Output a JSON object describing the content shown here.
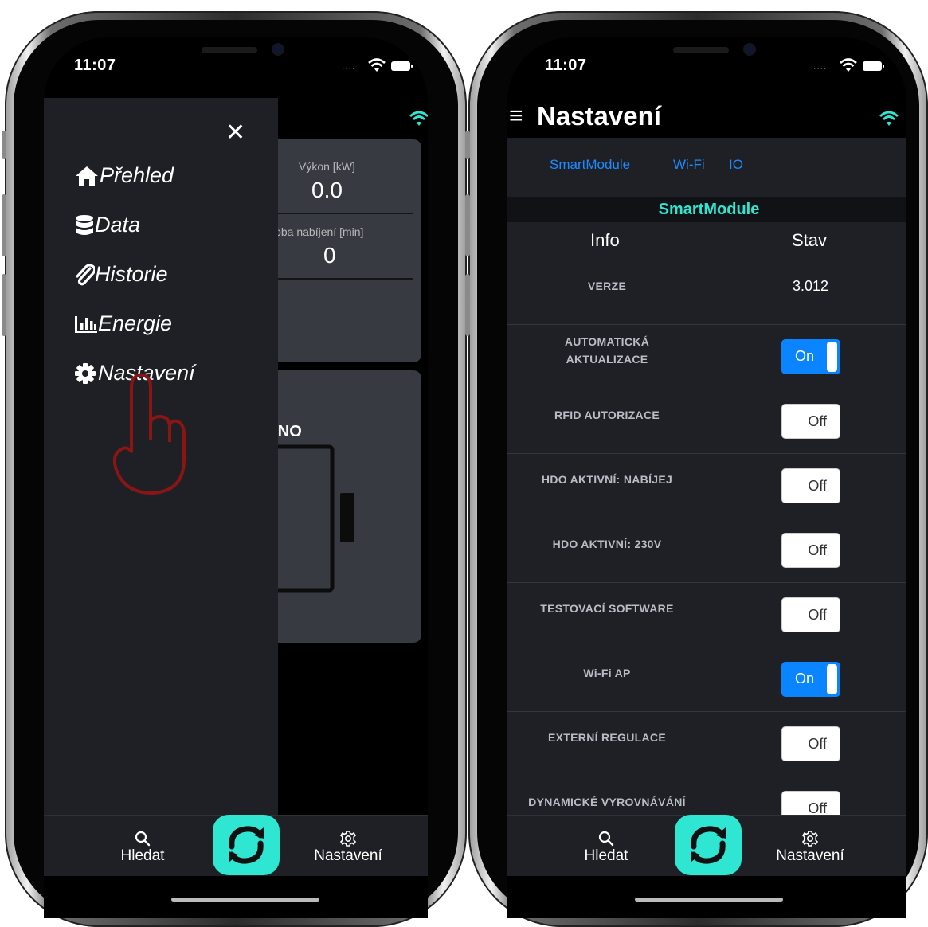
{
  "status_bar": {
    "time": "11:07"
  },
  "left_screen": {
    "stats": [
      {
        "label": "Výkon [kW]",
        "value": "0.0"
      },
      {
        "label": "Doba nabíjení [min]",
        "value": "0"
      }
    ],
    "status_text": "NENO",
    "drawer": {
      "close_symbol": "✕",
      "items": [
        {
          "label": "Přehled",
          "icon": "home-icon"
        },
        {
          "label": "Data",
          "icon": "database-icon"
        },
        {
          "label": "Historie",
          "icon": "paperclip-icon"
        },
        {
          "label": "Energie",
          "icon": "bar-chart-icon"
        },
        {
          "label": "Nastavení",
          "icon": "gear-icon"
        }
      ]
    }
  },
  "right_screen": {
    "header": {
      "menu_symbol": "≡",
      "title": "Nastavení"
    },
    "tabs": [
      "SmartModule",
      "Wi-Fi",
      "IO"
    ],
    "section_title": "SmartModule",
    "columns": {
      "info": "Info",
      "stav": "Stav"
    },
    "rows": [
      {
        "label": "VERZE",
        "value": "3.012"
      },
      {
        "label": "AUTOMATICKÁ AKTUALIZACE",
        "toggle": "On"
      },
      {
        "label": "RFID AUTORIZACE",
        "toggle": "Off"
      },
      {
        "label": "HDO AKTIVNÍ: NABÍJEJ",
        "toggle": "Off"
      },
      {
        "label": "HDO AKTIVNÍ: 230V",
        "toggle": "Off"
      },
      {
        "label": "TESTOVACÍ SOFTWARE",
        "toggle": "Off"
      },
      {
        "label": "Wi-Fi AP",
        "toggle": "On"
      },
      {
        "label": "EXTERNÍ REGULACE",
        "toggle": "Off"
      },
      {
        "label": "DYNAMICKÉ VYROVNÁVÁNÍ",
        "toggle": "Off"
      }
    ]
  },
  "tabbar": {
    "search_label": "Hledat",
    "settings_label": "Nastavení"
  },
  "colors": {
    "accent": "#2ee6d2",
    "link": "#1e8bff",
    "toggle_on": "#0a84ff",
    "tap_hand": "#8b1414"
  }
}
